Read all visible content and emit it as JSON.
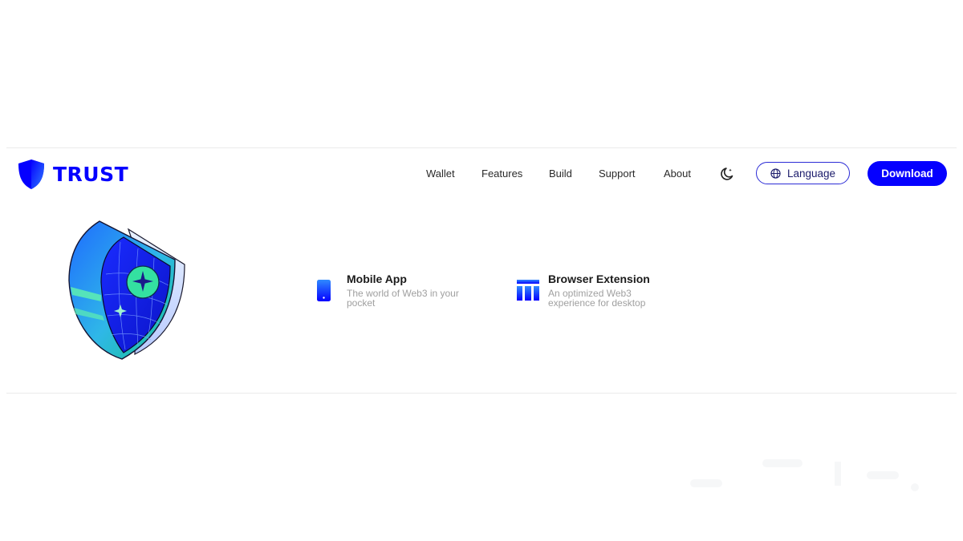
{
  "brand": {
    "name": "TRUST",
    "accent_color": "#0500ff",
    "icon": "shield-icon"
  },
  "nav": {
    "items": [
      {
        "label": "Wallet"
      },
      {
        "label": "Features"
      },
      {
        "label": "Build"
      },
      {
        "label": "Support"
      },
      {
        "label": "About"
      }
    ],
    "theme_toggle_icon": "moon-icon"
  },
  "language_button": {
    "label": "Language",
    "icon": "globe-icon"
  },
  "download_button": {
    "label": "Download"
  },
  "hero": {
    "illustration": "shield-illustration"
  },
  "products": [
    {
      "title": "Mobile App",
      "description": "The world of Web3 in your pocket",
      "icon": "phone-icon"
    },
    {
      "title": "Browser Extension",
      "description": "An optimized Web3 experience for desktop",
      "icon": "browser-extension-icon"
    }
  ]
}
